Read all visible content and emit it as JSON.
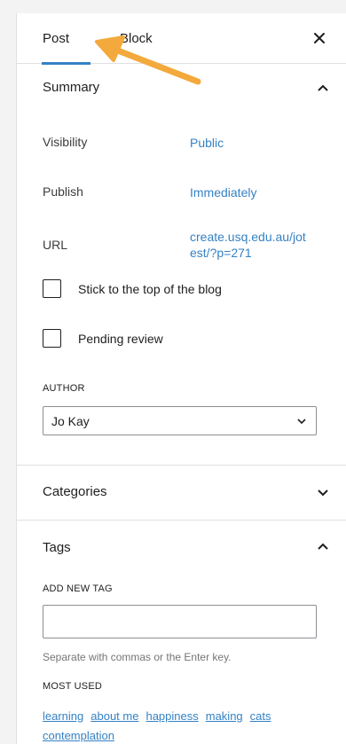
{
  "tabs": {
    "post": "Post",
    "block": "Block"
  },
  "summary": {
    "title": "Summary",
    "visibility_label": "Visibility",
    "visibility_value": "Public",
    "publish_label": "Publish",
    "publish_value": "Immediately",
    "url_label": "URL",
    "url_line1": "create.usq.edu.au/jot",
    "url_line2": "est/?p=271",
    "sticky_label": "Stick to the top of the blog",
    "pending_label": "Pending review",
    "author_label": "AUTHOR",
    "author_value": "Jo Kay"
  },
  "categories": {
    "title": "Categories"
  },
  "tags": {
    "title": "Tags",
    "add_label": "ADD NEW TAG",
    "input_value": "",
    "help": "Separate with commas or the Enter key.",
    "most_used_label": "MOST USED",
    "most_used": [
      "learning",
      "about me",
      "happiness",
      "making",
      "cats"
    ],
    "more": "contemplation"
  },
  "colors": {
    "accent": "#3582c4",
    "annotation_arrow": "#f3a93c"
  },
  "icons": {
    "close": "close-icon",
    "summary_toggle": "chevron-up-icon",
    "categories_toggle": "chevron-down-icon",
    "tags_toggle": "chevron-up-icon",
    "select": "chevron-down-icon",
    "annotation": "arrow-icon"
  }
}
